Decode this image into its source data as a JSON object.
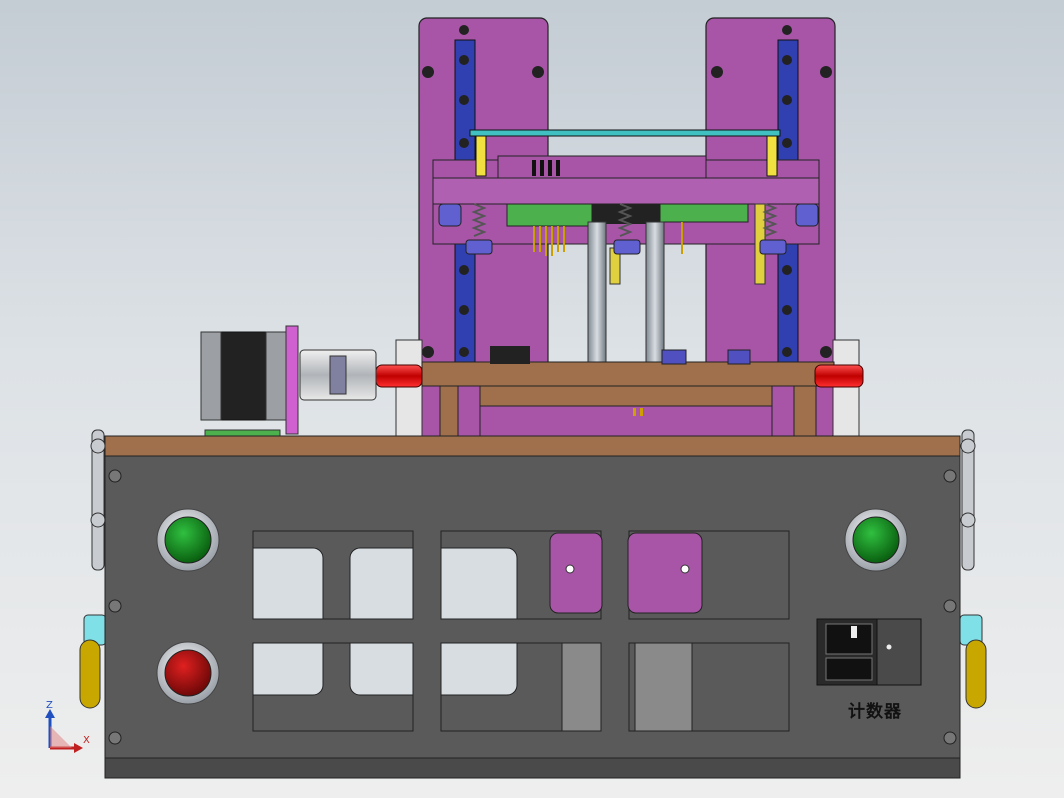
{
  "panel": {
    "counter_label": "计数器"
  },
  "triad": {
    "z_label": "Z",
    "x_label": "X"
  },
  "colors": {
    "frame_purple": "#a855a8",
    "rail_blue": "#3040b0",
    "base_wood": "#a0704c",
    "panel_gray": "#5a5a5a",
    "shaft_red": "#e01010",
    "button_green": "#109018",
    "button_red": "#b01010",
    "pcb_green": "#4cb04c"
  },
  "icons": [
    "start-button-icon",
    "stop-button-icon",
    "axis-triad-icon"
  ]
}
